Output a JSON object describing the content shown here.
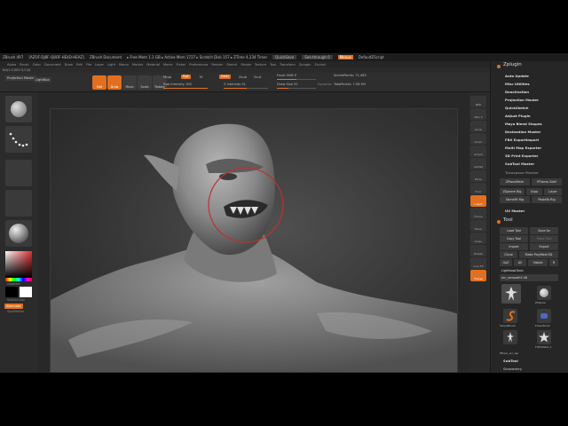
{
  "titlebar": {
    "app": "ZBrush 4R7",
    "file": "[AZOF-DJ8F-Q8OF-HE4D-HEAZ]",
    "doc": "ZBrush Document",
    "stats": "▸ Free Mem 1.1 GB ▸ Active Mem 1727 ▸ Scratch Disk 157 ▸ ZTime 4.234 Timer",
    "quicksave": "QuickSave",
    "seethrough": "See-through 0",
    "menus": "Menus",
    "script": "DefaultZScript"
  },
  "menubar": [
    "Alpha",
    "Brush",
    "Color",
    "Document",
    "Draw",
    "Edit",
    "File",
    "Layer",
    "Light",
    "Macro",
    "Marker",
    "Material",
    "Movie",
    "Picker",
    "Preferences",
    "Render",
    "Stencil",
    "Stroke",
    "Texture",
    "Tool",
    "Transform",
    "Zplugin",
    "Zscript"
  ],
  "infoline": "Kd(1.0,000 0,0,0)",
  "toolbar": {
    "projection_master": "Projection Master",
    "lightbox": "LightBox",
    "edit": "Edit",
    "draw": "Draw",
    "move": "Move",
    "scale": "Scale",
    "rotate": "Rotate",
    "mrgb": "Mrgb",
    "rgb": "Rgb",
    "m": "M",
    "zadd": "Zadd",
    "zsub": "Zsub",
    "zcut": "Zcut",
    "rgb_intensity": "Rgb Intensity 100",
    "z_intensity": "Z Intensity 51",
    "focal_shift": "Focal Shift 0",
    "draw_size": "Draw Size 52",
    "dynamic": "Dynamic",
    "active_points": "ActivePoints: 71,482",
    "total_points": "TotalPoints: 7.08 Mil"
  },
  "left_shelf": {
    "gradient": "Gradient",
    "switch_color": "SwitchColor",
    "alternate": "Alternate",
    "spix_palette": "SpixPalette"
  },
  "right_shelf": [
    "BPR",
    "SPix 3",
    "Scroll",
    "Zoom",
    "Actual",
    "AAHalf",
    "Persp",
    "Floor",
    "L.Sym",
    "Frame",
    "Move",
    "Scale",
    "Rotate",
    "Line Fill",
    "Transp"
  ],
  "zplugin": {
    "title": "Zplugin",
    "items": [
      "Auto Update",
      "Misc Utilities",
      "Deactivation",
      "Projection Master",
      "QuickSketch",
      "Adjust Plugin",
      "Maya Blend Shapes",
      "Decimation Master",
      "FBX ExportImport",
      "Multi Map Exporter",
      "3D Print Exporter",
      "SubTool Master",
      "Transpose Master"
    ],
    "buttons": [
      "ZPlaneMesh",
      "PFlanes Sdef",
      "ZSphere Rig",
      "Grpa",
      "Layer",
      "SbmeFit Rig",
      "PasteTo Rig"
    ],
    "uv_master": "UV Master"
  },
  "tool": {
    "title": "Tool",
    "buttons": [
      "Load Tool",
      "Save As",
      "Copy Tool",
      "Paste Tool",
      "Import",
      "Export",
      "Clone",
      "Make PolyMesh3D",
      "GoZ",
      "All",
      "Visible",
      "R"
    ],
    "lightbox_tools": "Lightbox▸Tools",
    "current_tool": "orc_ssmooth3 48",
    "tiles": [
      "ZSphere",
      "SimpleBrush",
      "EraserBrush",
      "TXPreMesh_1",
      "PPoser_orc_ssp"
    ],
    "subtool": "SubTool",
    "geometry": "Geometry"
  }
}
